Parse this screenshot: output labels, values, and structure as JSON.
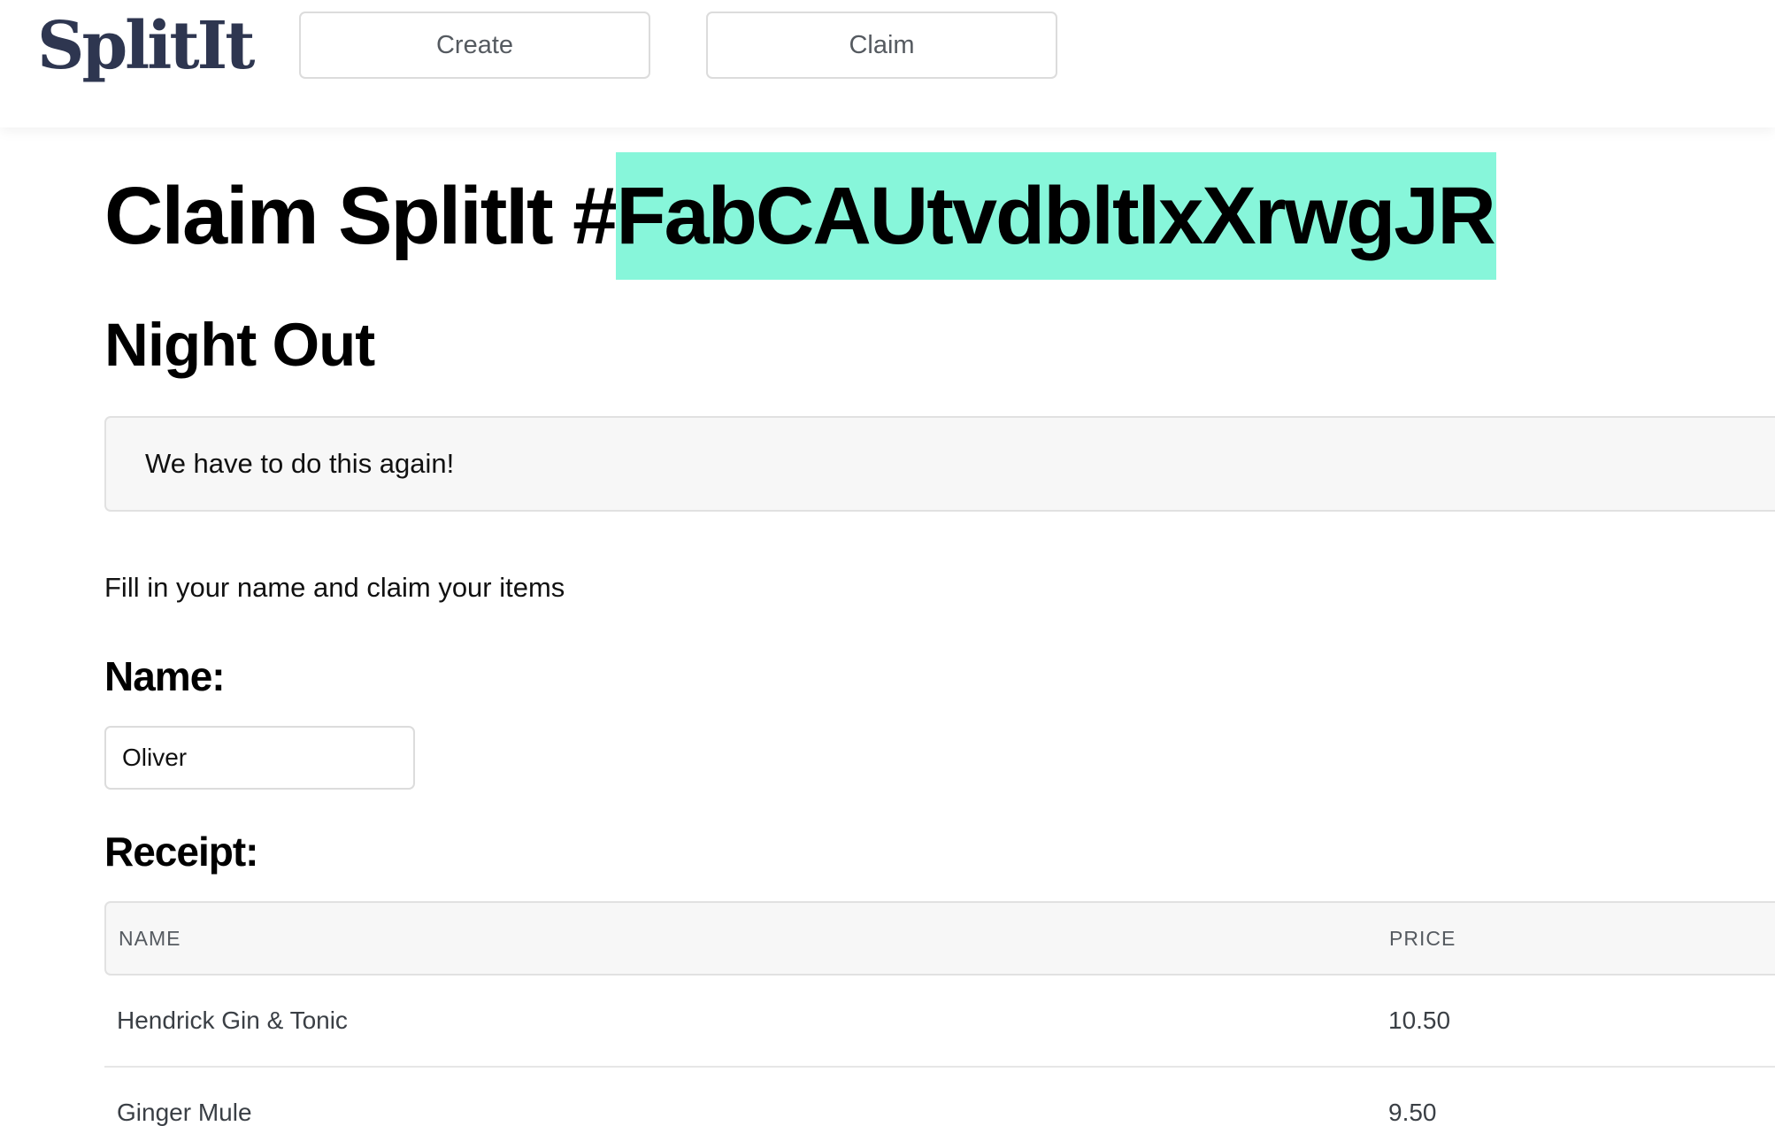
{
  "header": {
    "logo": "SplitIt",
    "nav": {
      "create_label": "Create",
      "claim_label": "Claim"
    }
  },
  "main": {
    "title_prefix": "Claim SplitIt #",
    "title_code": "FabCAUtvdbltlxXrwgJR",
    "subtitle": "Night Out",
    "message": "We have to do this again!",
    "instruction": "Fill in your name and claim your items",
    "name_label": "Name:",
    "name_value": "Oliver",
    "receipt_label": "Receipt:"
  },
  "receipt": {
    "columns": [
      "NAME",
      "PRICE"
    ],
    "rows": [
      {
        "name": "Hendrick Gin & Tonic",
        "price": "10.50"
      },
      {
        "name": "Ginger Mule",
        "price": "9.50"
      }
    ]
  },
  "colors": {
    "highlight": "#87f6da",
    "logo": "#2e3650"
  }
}
